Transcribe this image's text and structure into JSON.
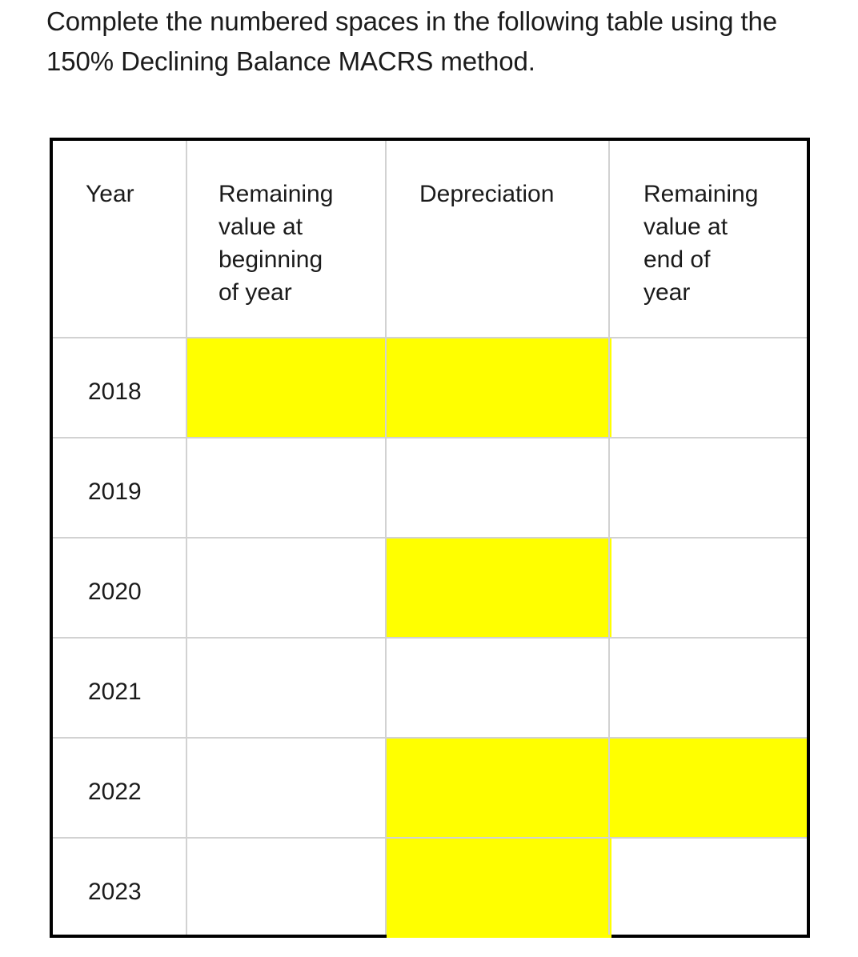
{
  "question": {
    "text": "Complete the numbered spaces in the following table using the 150% Declining Balance MACRS method.",
    "line1": "Complete the numbered spaces in the following",
    "line2": "table using the 150% Declining Balance MACRS",
    "line3": "method."
  },
  "table": {
    "headers": [
      {
        "label": "Year",
        "lines": [
          "Year"
        ]
      },
      {
        "label": "Remaining value at beginning of year",
        "lines": [
          "Remaining",
          "value at",
          "beginning",
          "of year"
        ]
      },
      {
        "label": "Depreciation",
        "lines": [
          "Depreciation"
        ]
      },
      {
        "label": "Remaining value at end of year",
        "lines": [
          "Remaining",
          "value at",
          "end of",
          "year"
        ]
      }
    ],
    "rows": [
      {
        "year": "2018",
        "beginning_value": "",
        "depreciation": "",
        "end_value": "",
        "highlighted": [
          "beginning_value",
          "depreciation"
        ]
      },
      {
        "year": "2019",
        "beginning_value": "",
        "depreciation": "",
        "end_value": "",
        "highlighted": []
      },
      {
        "year": "2020",
        "beginning_value": "",
        "depreciation": "",
        "end_value": "",
        "highlighted": [
          "depreciation"
        ]
      },
      {
        "year": "2021",
        "beginning_value": "",
        "depreciation": "",
        "end_value": "",
        "highlighted": []
      },
      {
        "year": "2022",
        "beginning_value": "",
        "depreciation": "",
        "end_value": "",
        "highlighted": [
          "depreciation",
          "end_value"
        ]
      },
      {
        "year": "2023",
        "beginning_value": "",
        "depreciation": "",
        "end_value": "",
        "highlighted": [
          "depreciation"
        ]
      }
    ]
  },
  "colors": {
    "highlight": "#ffff00",
    "table_border": "#000000",
    "grid_line": "#d2d2d2",
    "text": "#1b1b1b",
    "background": "#ffffff"
  }
}
